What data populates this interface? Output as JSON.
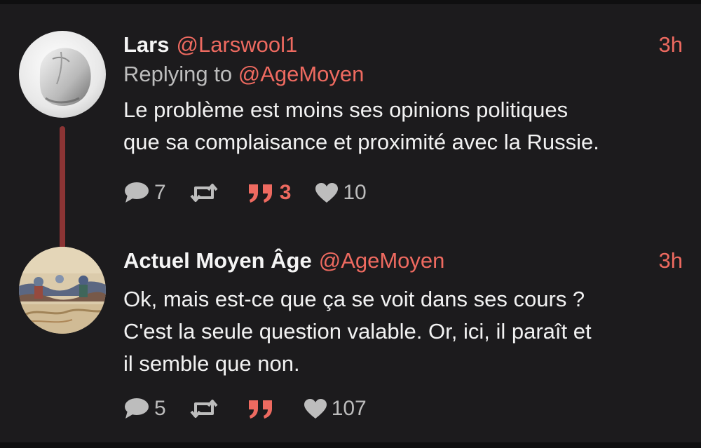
{
  "tweets": [
    {
      "display_name": "Lars",
      "handle": "@Larswool1",
      "time": "3h",
      "replying_prefix": "Replying to",
      "replying_to": "@AgeMoyen",
      "text_lines": [
        "Le problème est moins ses opinions politiques",
        "que sa complaisance et proximité avec la Russie."
      ],
      "replies": "7",
      "retweets": "",
      "quotes": "3",
      "likes": "10",
      "avatar_icon": "computer-mouse-avatar"
    },
    {
      "display_name": "Actuel Moyen Âge",
      "handle": "@AgeMoyen",
      "time": "3h",
      "text_lines": [
        "Ok, mais est-ce que ça se voit dans ses cours ?",
        "C'est la seule question valable. Or, ici, il paraît et",
        "il semble que non."
      ],
      "replies": "5",
      "retweets": "",
      "quotes": "",
      "likes": "107",
      "avatar_icon": "medieval-illustration-avatar"
    }
  ],
  "colors": {
    "background": "#1c1b1d",
    "accent": "#ee6a60",
    "thread_line": "#8b3434",
    "muted_text": "#bdbdbd"
  },
  "icons": {
    "reply": "speech-bubble-icon",
    "retweet": "retweet-icon",
    "quote": "quote-icon",
    "like": "heart-icon"
  }
}
